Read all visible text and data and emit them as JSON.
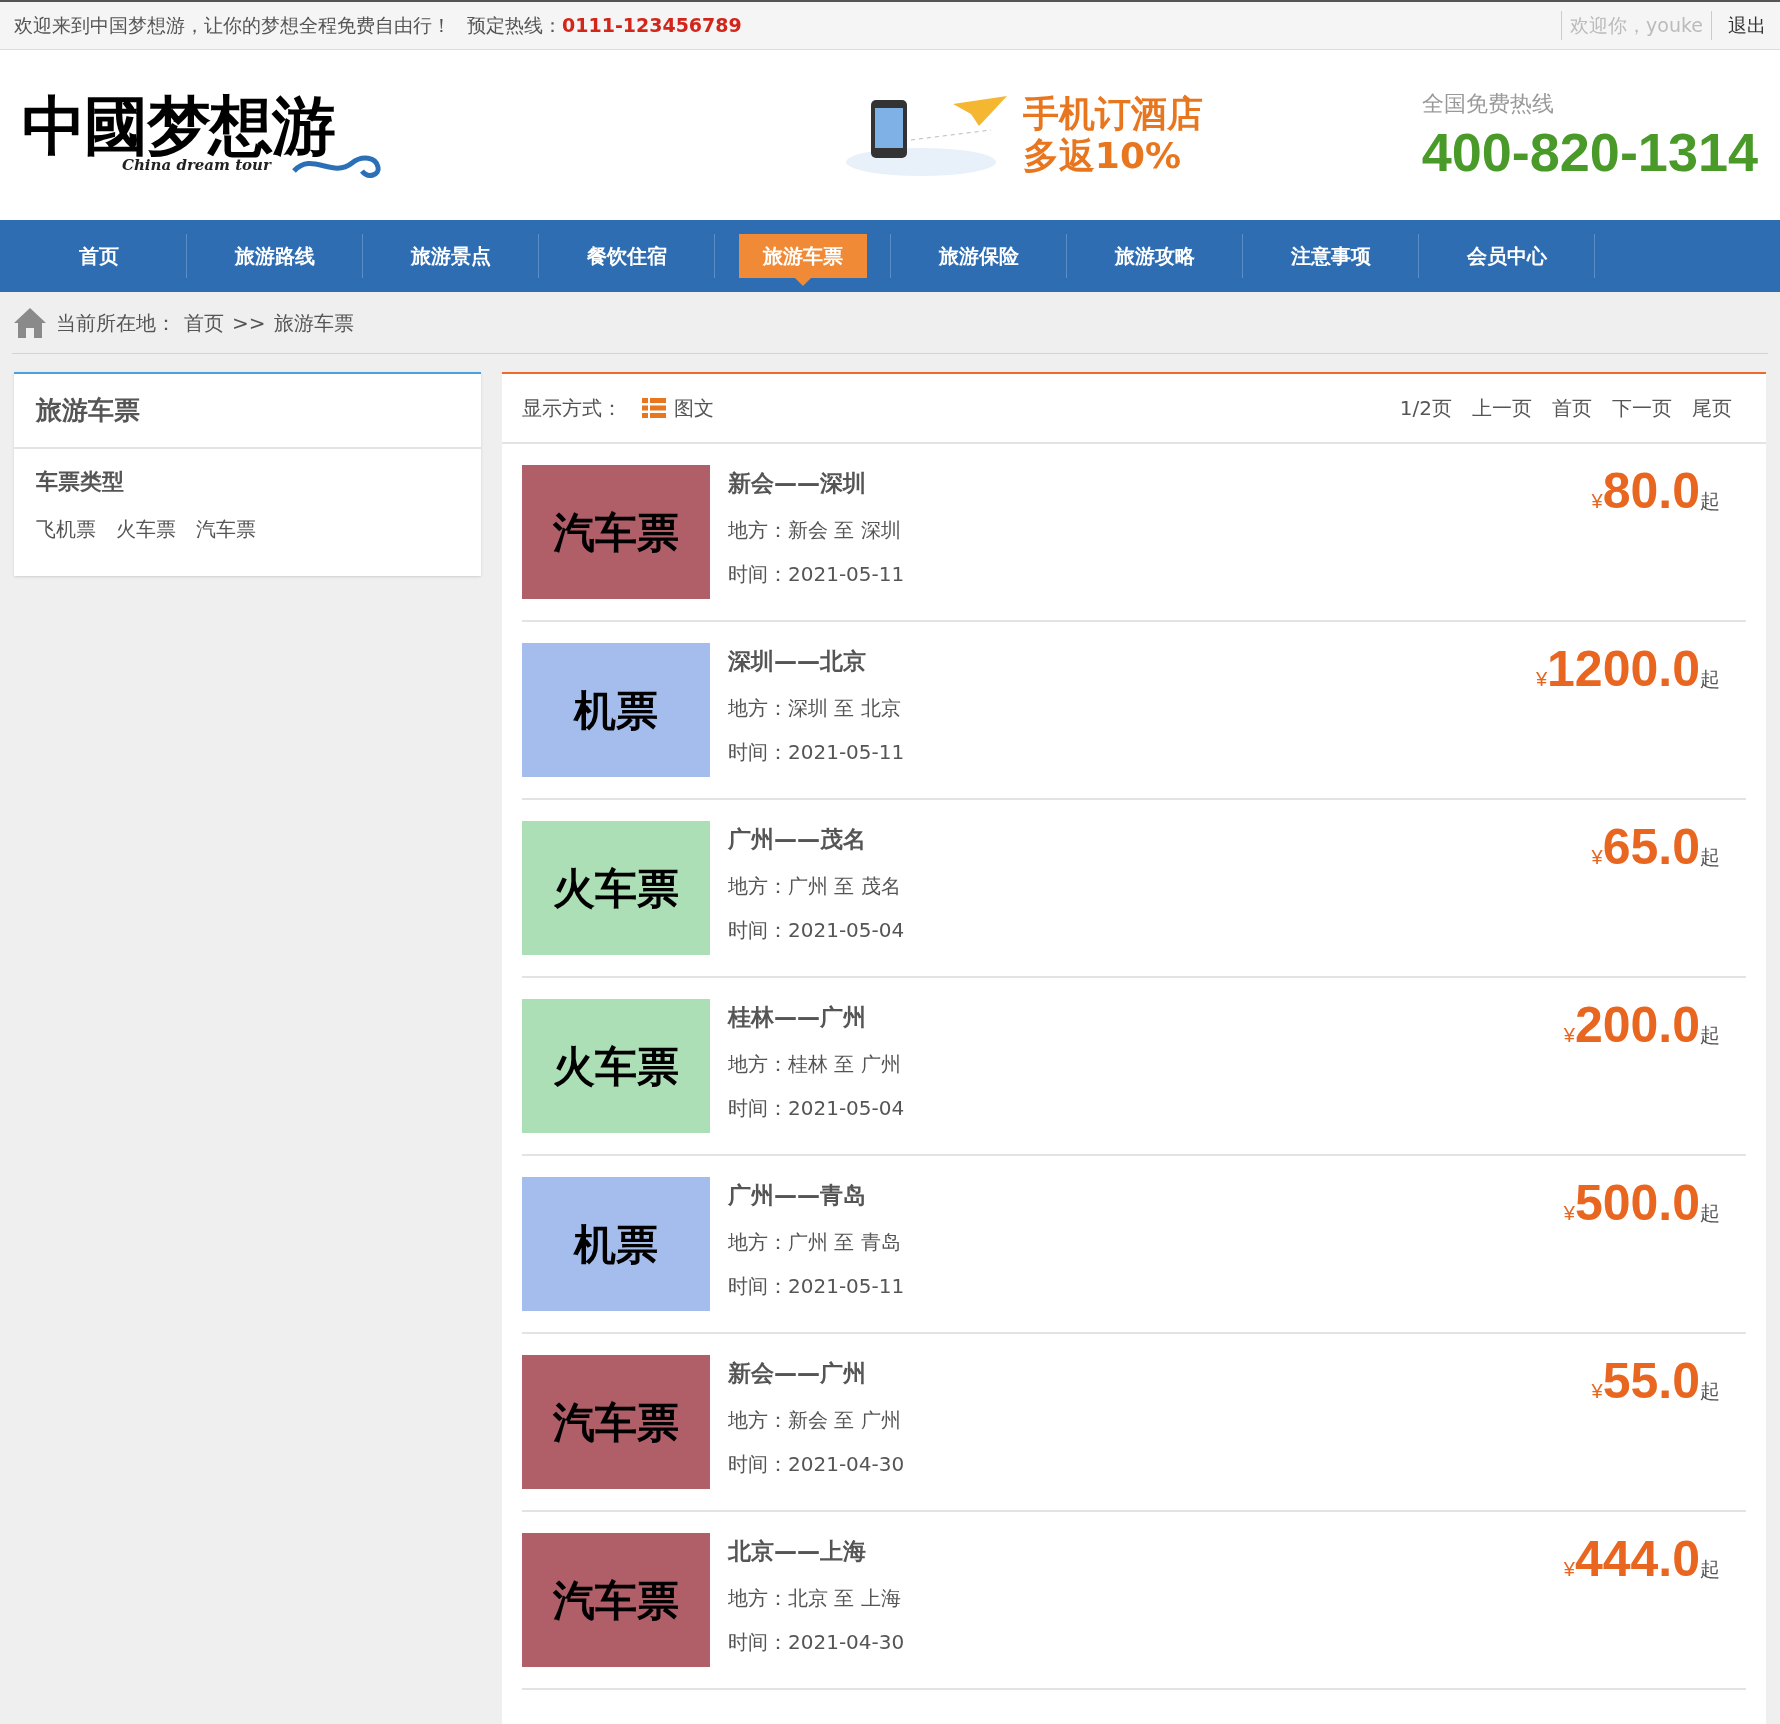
{
  "top_bar": {
    "welcome": "欢迎来到中国梦想游，让你的梦想全程免费自由行！",
    "hotline_label": "预定热线：",
    "hotline": "0111-123456789",
    "greeting": "欢迎你，youke",
    "logout": "退出"
  },
  "header": {
    "logo": {
      "text": "中國梦想游",
      "tagline": "China dream tour"
    },
    "promo": [
      "手机订酒店",
      "多返10%"
    ],
    "hotline_label": "全国免费热线",
    "hotline": "400-820-1314"
  },
  "nav": [
    {
      "label": "首页",
      "selected": false
    },
    {
      "label": "旅游路线",
      "selected": false
    },
    {
      "label": "旅游景点",
      "selected": false
    },
    {
      "label": "餐饮住宿",
      "selected": false
    },
    {
      "label": "旅游车票",
      "selected": true
    },
    {
      "label": "旅游保险",
      "selected": false
    },
    {
      "label": "旅游攻略",
      "selected": false
    },
    {
      "label": "注意事项",
      "selected": false
    },
    {
      "label": "会员中心",
      "selected": false
    }
  ],
  "breadcrumb": {
    "label": "当前所在地：",
    "items": [
      "首页",
      ">>",
      "旅游车票"
    ]
  },
  "sidebar": {
    "title": "旅游车票",
    "section": "车票类型",
    "links": [
      "飞机票",
      "火车票",
      "汽车票"
    ]
  },
  "toolbar": {
    "display_label": "显示方式：",
    "display_mode": "图文",
    "pagination": [
      "1/2页",
      "上一页",
      "首页",
      "下一页",
      "尾页"
    ]
  },
  "tickets": [
    {
      "image_text": "汽车票",
      "color": "#b05e68",
      "title": "新会——深圳",
      "place": "地方：新会 至 深圳",
      "time": "时间：2021-05-11",
      "currency": "¥",
      "price": "80.0",
      "suffix": "起"
    },
    {
      "image_text": "机票",
      "color": "#a4bdec",
      "title": "深圳——北京",
      "place": "地方：深圳 至 北京",
      "time": "时间：2021-05-11",
      "currency": "¥",
      "price": "1200.0",
      "suffix": "起"
    },
    {
      "image_text": "火车票",
      "color": "#addfb6",
      "title": "广州——茂名",
      "place": "地方：广州 至 茂名",
      "time": "时间：2021-05-04",
      "currency": "¥",
      "price": "65.0",
      "suffix": "起"
    },
    {
      "image_text": "火车票",
      "color": "#addfb6",
      "title": "桂林——广州",
      "place": "地方：桂林 至 广州",
      "time": "时间：2021-05-04",
      "currency": "¥",
      "price": "200.0",
      "suffix": "起"
    },
    {
      "image_text": "机票",
      "color": "#a4bdec",
      "title": "广州——青岛",
      "place": "地方：广州 至 青岛",
      "time": "时间：2021-05-11",
      "currency": "¥",
      "price": "500.0",
      "suffix": "起"
    },
    {
      "image_text": "汽车票",
      "color": "#b05e68",
      "title": "新会——广州",
      "place": "地方：新会 至 广州",
      "time": "时间：2021-04-30",
      "currency": "¥",
      "price": "55.0",
      "suffix": "起"
    },
    {
      "image_text": "汽车票",
      "color": "#b05e68",
      "title": "北京——上海",
      "place": "地方：北京 至 上海",
      "time": "时间：2021-04-30",
      "currency": "¥",
      "price": "444.0",
      "suffix": "起"
    }
  ]
}
